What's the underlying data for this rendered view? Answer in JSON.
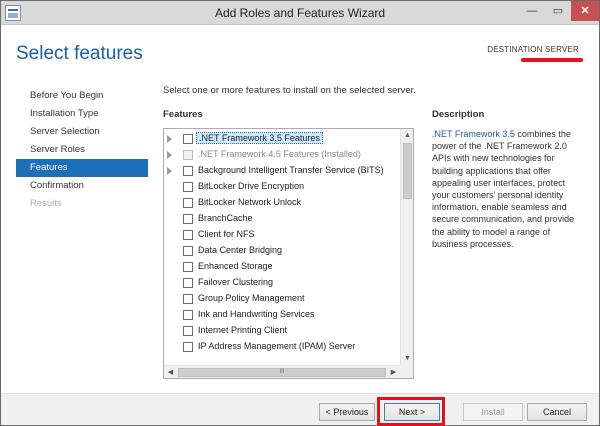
{
  "window": {
    "title": "Add Roles and Features Wizard",
    "controls": {
      "minimize": "—",
      "maximize": "▭",
      "close": "✕"
    }
  },
  "header": {
    "page_title": "Select features",
    "destination_label": "DESTINATION SERVER"
  },
  "nav": {
    "items": [
      {
        "label": "Before You Begin",
        "state": "normal"
      },
      {
        "label": "Installation Type",
        "state": "normal"
      },
      {
        "label": "Server Selection",
        "state": "normal"
      },
      {
        "label": "Server Roles",
        "state": "normal"
      },
      {
        "label": "Features",
        "state": "active"
      },
      {
        "label": "Confirmation",
        "state": "normal"
      },
      {
        "label": "Results",
        "state": "disabled"
      }
    ]
  },
  "main": {
    "instructions": "Select one or more features to install on the selected server.",
    "features_header": "Features",
    "description_header": "Description",
    "features": [
      {
        "label": ".NET Framework 3.5 Features",
        "expandable": true,
        "checked": false,
        "selected": true,
        "installed": false
      },
      {
        "label": ".NET Framework 4.5 Features (Installed)",
        "expandable": true,
        "checked": false,
        "selected": false,
        "installed": true
      },
      {
        "label": "Background Intelligent Transfer Service (BITS)",
        "expandable": true,
        "checked": false,
        "selected": false,
        "installed": false
      },
      {
        "label": "BitLocker Drive Encryption",
        "expandable": false,
        "checked": false,
        "selected": false,
        "installed": false
      },
      {
        "label": "BitLocker Network Unlock",
        "expandable": false,
        "checked": false,
        "selected": false,
        "installed": false
      },
      {
        "label": "BranchCache",
        "expandable": false,
        "checked": false,
        "selected": false,
        "installed": false
      },
      {
        "label": "Client for NFS",
        "expandable": false,
        "checked": false,
        "selected": false,
        "installed": false
      },
      {
        "label": "Data Center Bridging",
        "expandable": false,
        "checked": false,
        "selected": false,
        "installed": false
      },
      {
        "label": "Enhanced Storage",
        "expandable": false,
        "checked": false,
        "selected": false,
        "installed": false
      },
      {
        "label": "Failover Clustering",
        "expandable": false,
        "checked": false,
        "selected": false,
        "installed": false
      },
      {
        "label": "Group Policy Management",
        "expandable": false,
        "checked": false,
        "selected": false,
        "installed": false
      },
      {
        "label": "Ink and Handwriting Services",
        "expandable": false,
        "checked": false,
        "selected": false,
        "installed": false
      },
      {
        "label": "Internet Printing Client",
        "expandable": false,
        "checked": false,
        "selected": false,
        "installed": false
      },
      {
        "label": "IP Address Management (IPAM) Server",
        "expandable": false,
        "checked": false,
        "selected": false,
        "installed": false
      }
    ],
    "description": {
      "link": ".NET Framework 3.5",
      "text": " combines the power of the .NET Framework 2.0 APIs with new technologies for building applications that offer appealing user interfaces, protect your customers' personal identity information, enable seamless and secure communication, and provide the ability to model a range of business processes."
    },
    "scroll": {
      "up": "▲",
      "down": "▼",
      "left": "◀",
      "right": "▶",
      "grip": "III"
    }
  },
  "footer": {
    "previous": "< Previous",
    "next": "Next >",
    "install": "Install",
    "cancel": "Cancel"
  },
  "colors": {
    "accent": "#1d6fb8",
    "title_blue": "#1a5ea8",
    "highlight_red": "#e0121c"
  }
}
